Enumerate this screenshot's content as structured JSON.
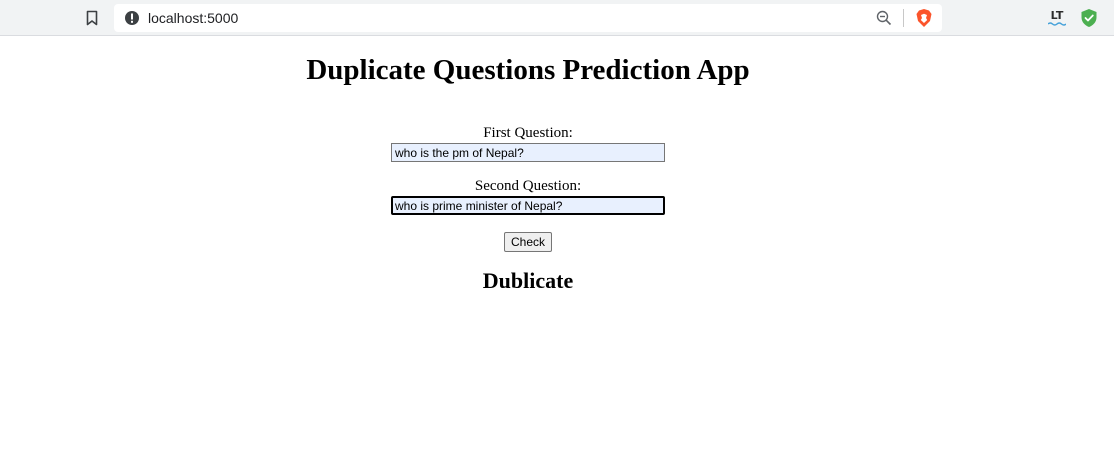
{
  "browser": {
    "url": "localhost:5000",
    "icons": {
      "bookmark": "bookmark-icon",
      "site_info": "info-icon",
      "zoom": "zoom-out-icon",
      "brave": "brave-shields-icon",
      "extension_1": "languagetool-icon",
      "extension_2": "shield-check-icon"
    },
    "extension_1_label": "LT",
    "colors": {
      "brave": "#fb542b",
      "shield_ext": "#4caf50",
      "lt_wave": "#45a1d9"
    }
  },
  "page": {
    "title": "Duplicate Questions Prediction App",
    "form": {
      "first_label": "First Question:",
      "first_value": "who is the pm of Nepal?",
      "second_label": "Second Question:",
      "second_value": "who is prime minister of Nepal?",
      "submit_label": "Check"
    },
    "result": "Dublicate"
  }
}
